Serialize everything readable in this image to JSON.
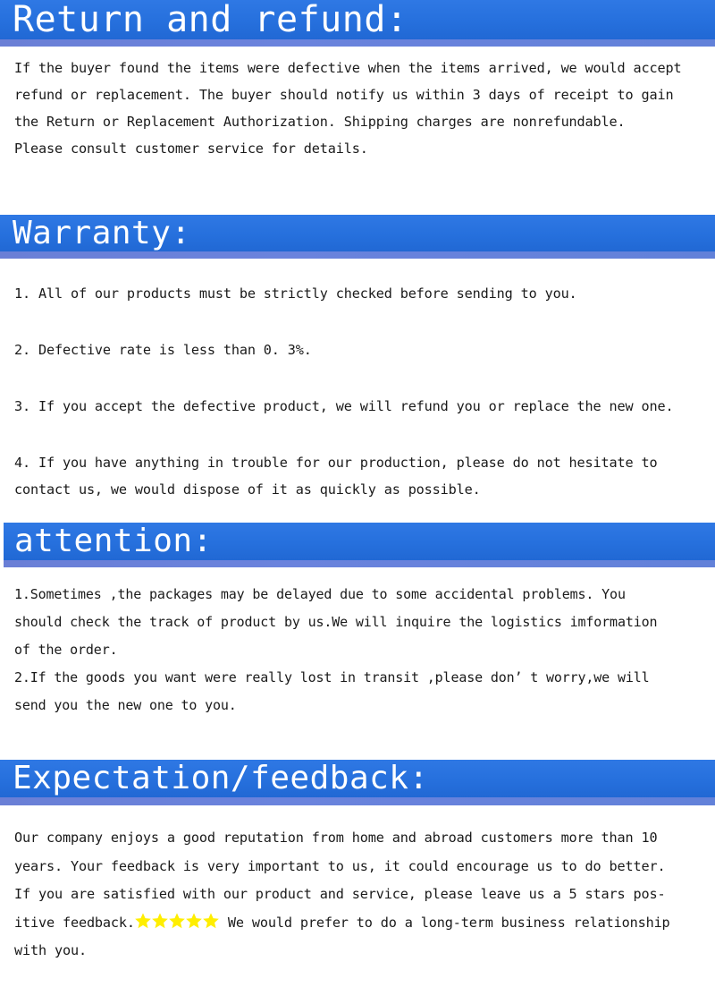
{
  "colors": {
    "band_blue": "#2670dd",
    "band_strip": "#6a83dd",
    "star_yellow": "#ffee00",
    "text": "#1a1a1a",
    "band_title": "#ffffff"
  },
  "sections": {
    "return": {
      "heading": "Return and refund:",
      "paragraph": "If the buyer found the items were defective when the items arrived, we would accept\nrefund or replacement. The buyer should notify us within 3 days of receipt to gain\nthe Return or Replacement Authorization. Shipping charges are nonrefundable.\nPlease consult customer service for details."
    },
    "warranty": {
      "heading": "Warranty:",
      "items": [
        "1. All of our products must be strictly checked before sending to you.",
        "2. Defective rate is less than 0. 3%.",
        "3. If you accept the defective product, we will refund you or replace the new one.",
        "4. If you have anything in trouble for our production, please do not hesitate to\ncontact us, we would dispose of it as quickly as possible."
      ]
    },
    "attention": {
      "heading": "attention:",
      "items": [
        "1.Sometimes ,the packages may be delayed due to some accidental problems. You\nshould check the track of product by us.We will inquire the logistics imformation\nof the order.",
        "2.If the goods you want were really lost in transit ,please don’ t worry,we will\nsend you the new one to you."
      ]
    },
    "expectation": {
      "heading": "Expectation/feedback:",
      "paragraph_before_stars": "Our company enjoys a good reputation from home and abroad customers more than 10\nyears. Your feedback is very important to us, it could encourage us to do better.\nIf you are satisfied with our product and service, please leave us a 5 stars pos-\nitive feedback.",
      "star_count": 5,
      "star_icon": "star-icon",
      "paragraph_after_stars": " We would prefer to do a long-term business relationship\nwith you."
    }
  }
}
